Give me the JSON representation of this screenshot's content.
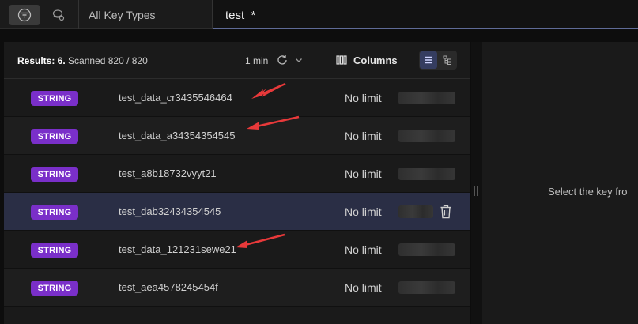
{
  "toolbar": {
    "key_type_filter": "All Key Types",
    "search_value": "test_*"
  },
  "list": {
    "results_label": "Results: 6.",
    "scanned_label": "Scanned 820 / 820",
    "refresh_interval": "1 min",
    "columns_label": "Columns",
    "rows": [
      {
        "type": "STRING",
        "name": "test_data_cr3435546464",
        "ttl": "No limit"
      },
      {
        "type": "STRING",
        "name": "test_data_a34354354545",
        "ttl": "No limit"
      },
      {
        "type": "STRING",
        "name": "test_a8b18732vyyt21",
        "ttl": "No limit"
      },
      {
        "type": "STRING",
        "name": "test_dab32434354545",
        "ttl": "No limit"
      },
      {
        "type": "STRING",
        "name": "test_data_121231sewe21",
        "ttl": "No limit"
      },
      {
        "type": "STRING",
        "name": "test_aea4578245454f",
        "ttl": "No limit"
      }
    ]
  },
  "detail": {
    "hint": "Select the key fro"
  },
  "colors": {
    "string_badge": "#7a2fc9",
    "selected_row": "#2a2e45",
    "annotation_arrow": "#e8393a"
  }
}
